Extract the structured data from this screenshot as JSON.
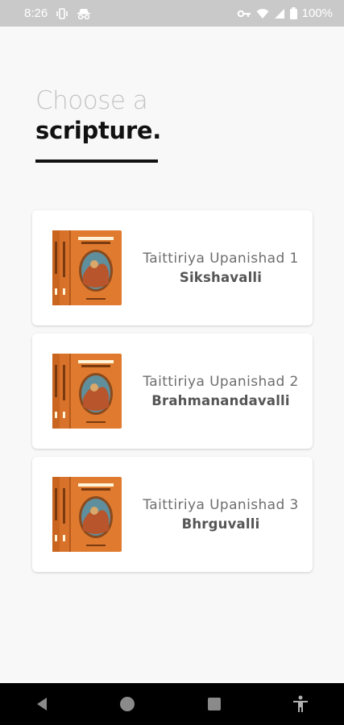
{
  "status_bar": {
    "time": "8:26",
    "battery": "100%",
    "icons": [
      "vibrate-icon",
      "incognito-icon",
      "vpn-key-icon",
      "wifi-icon",
      "signal-icon",
      "battery-icon"
    ]
  },
  "header": {
    "line1": "Choose a",
    "line2": "scripture."
  },
  "scriptures": [
    {
      "title": "Taittiriya Upanishad 1",
      "subtitle": "Sikshavalli"
    },
    {
      "title": "Taittiriya Upanishad 2",
      "subtitle": "Brahmanandavalli"
    },
    {
      "title": "Taittiriya Upanishad 3",
      "subtitle": "Bhrguvalli"
    }
  ],
  "nav_bar": {
    "icons": [
      "back-icon",
      "home-icon",
      "recents-icon",
      "accessibility-icon"
    ]
  },
  "colors": {
    "status_bar": "#c9c9c9",
    "background": "#f8f8f8",
    "book_orange": "#e07a2e",
    "nav_bar": "#000000"
  }
}
